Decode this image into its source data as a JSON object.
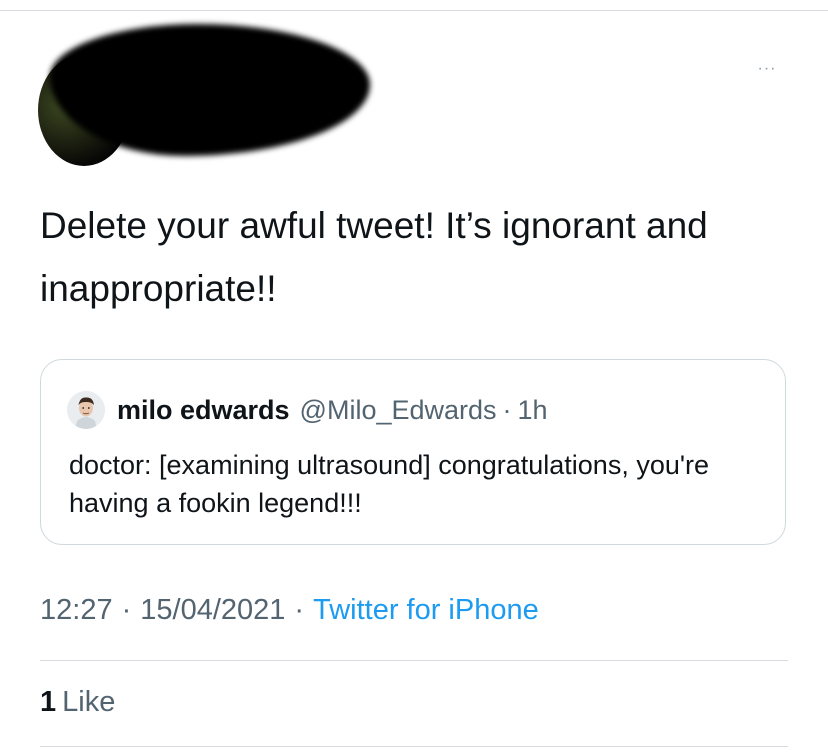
{
  "tweet": {
    "more_label": "···",
    "text": "Delete your awful tweet! It’s ignorant and inappropriate!!",
    "time": "12:27",
    "date": "15/04/2021",
    "separator": "·",
    "source": "Twitter for iPhone",
    "likes_count": "1",
    "likes_label": "Like"
  },
  "quote": {
    "name": "milo edwards",
    "handle": "@Milo_Edwards",
    "separator": "·",
    "age": "1h",
    "text": "doctor: [examining ultrasound] congratulations, you're having a fookin legend!!!"
  },
  "colors": {
    "accent": "#1d9bf0",
    "secondary_text": "#536471",
    "primary_text": "#0f1419",
    "border": "#cfd9de"
  },
  "icons": {
    "more": "more-horizontal-icon"
  }
}
